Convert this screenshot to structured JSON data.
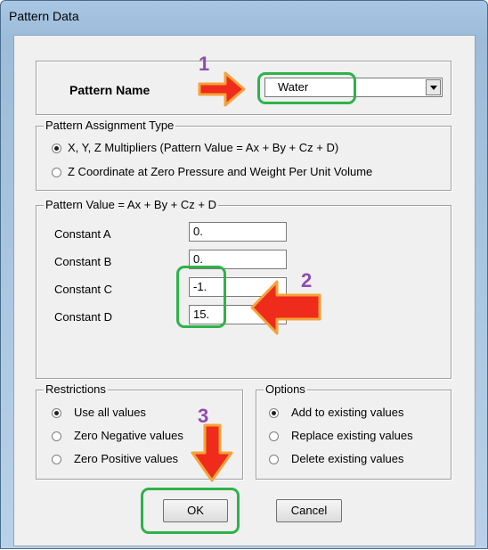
{
  "window": {
    "title": "Pattern Data"
  },
  "pattern_name": {
    "label": "Pattern Name",
    "value": "Water"
  },
  "assignment": {
    "legend": "Pattern Assignment Type",
    "option_1": "X, Y, Z Multipliers  (Pattern Value = Ax + By + Cz + D)",
    "option_2": "Z Coordinate at Zero Pressure and Weight Per Unit Volume"
  },
  "pattern_value": {
    "legend": "Pattern Value =  Ax + By + Cz + D",
    "constants": [
      {
        "label": "Constant  A",
        "value": "0."
      },
      {
        "label": "Constant  B",
        "value": "0."
      },
      {
        "label": "Constant  C",
        "value": "-1."
      },
      {
        "label": "Constant  D",
        "value": "15."
      }
    ]
  },
  "restrictions": {
    "legend": "Restrictions",
    "options": [
      "Use all values",
      "Zero Negative values",
      "Zero Positive values"
    ],
    "selected": "Use all values"
  },
  "options": {
    "legend": "Options",
    "options": [
      "Add to existing values",
      "Replace existing values",
      "Delete existing values"
    ],
    "selected": "Add to existing values"
  },
  "buttons": {
    "ok": "OK",
    "cancel": "Cancel"
  },
  "annotations": {
    "step_1": "1",
    "step_2": "2",
    "step_3": "3",
    "arrow_color": "#ef2b1b",
    "highlight_color": "#2fb24a",
    "number_color": "#8e4cb0"
  }
}
